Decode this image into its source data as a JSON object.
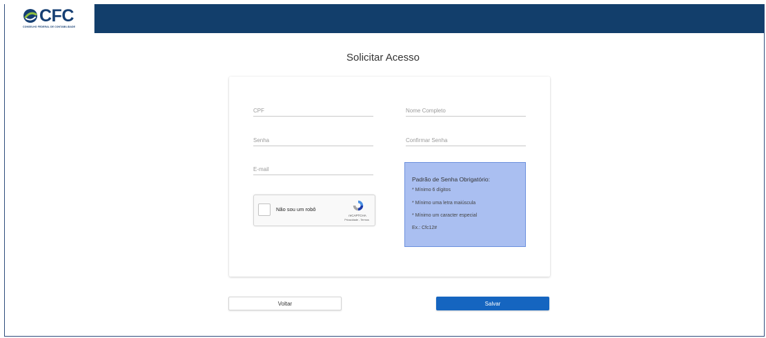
{
  "header": {
    "logo_text": "CFC",
    "logo_subtitle": "CONSELHO FEDERAL DE CONTABILIDADE",
    "brand_color": "#123e6b"
  },
  "page": {
    "title": "Solicitar Acesso"
  },
  "form": {
    "cpf_placeholder": "CPF",
    "nome_placeholder": "Nome Completo",
    "senha_placeholder": "Senha",
    "confirmar_placeholder": "Confirmar Senha",
    "email_placeholder": "E-mail"
  },
  "recaptcha": {
    "label": "Não sou um robô",
    "brand": "reCAPTCHA",
    "links": "Privacidade - Termos"
  },
  "password_rules": {
    "title": "Padrão de Senha Obrigatório:",
    "rule_1": "* Mínimo 6 dígitos",
    "rule_2": "* Mínimo uma letra maiúscula",
    "rule_3": "* Mínimo um caracter especial",
    "example": "Ex.: Cfc12#",
    "background_color": "#aabff1"
  },
  "buttons": {
    "back_label": "Voltar",
    "save_label": "Salvar",
    "save_color": "#1565c0"
  }
}
